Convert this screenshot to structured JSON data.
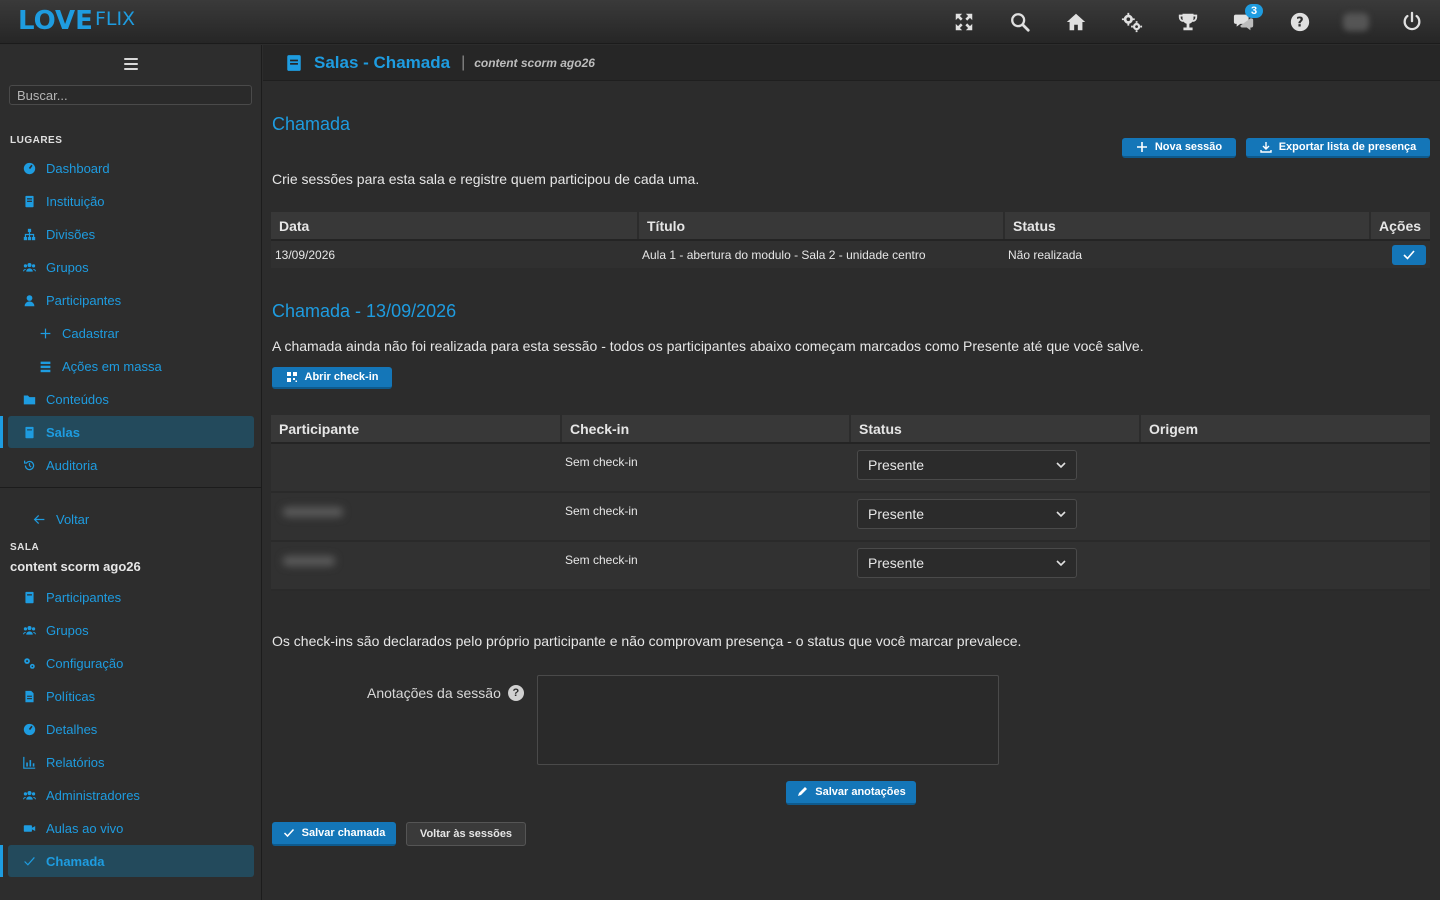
{
  "app": {
    "logo_love": "LOVE",
    "logo_flix": "FLIX",
    "notification_count": "3"
  },
  "colors": {
    "accent": "#1e9ce0",
    "button": "#1476b8",
    "background": "#2c2c2c"
  },
  "topbar_icons": [
    "fullscreen-icon",
    "search-icon",
    "home-icon",
    "settings-icon",
    "trophy-icon",
    "chat-icon",
    "help-icon",
    "avatar",
    "power-icon"
  ],
  "sidebar": {
    "search_placeholder": "Buscar...",
    "places_label": "LUGARES",
    "items": [
      {
        "label": "Dashboard",
        "icon": "dashboard-icon"
      },
      {
        "label": "Instituição",
        "icon": "building-icon"
      },
      {
        "label": "Divisões",
        "icon": "sitemap-icon"
      },
      {
        "label": "Grupos",
        "icon": "users-icon"
      },
      {
        "label": "Participantes",
        "icon": "user-icon"
      },
      {
        "label": "Cadastrar",
        "icon": "plus-icon"
      },
      {
        "label": "Ações em massa",
        "icon": "list-icon"
      },
      {
        "label": "Conteúdos",
        "icon": "folder-icon"
      },
      {
        "label": "Salas",
        "icon": "book-icon"
      },
      {
        "label": "Auditoria",
        "icon": "history-icon"
      }
    ],
    "back_label": "Voltar",
    "sala_label": "SALA",
    "sala_name": "content scorm ago26",
    "sala_items": [
      {
        "label": "Participantes",
        "icon": "book-icon"
      },
      {
        "label": "Grupos",
        "icon": "users-icon"
      },
      {
        "label": "Configuração",
        "icon": "cogs-icon"
      },
      {
        "label": "Políticas",
        "icon": "document-icon"
      },
      {
        "label": "Detalhes",
        "icon": "dashboard-icon"
      },
      {
        "label": "Relatórios",
        "icon": "chart-icon"
      },
      {
        "label": "Administradores",
        "icon": "users-icon"
      },
      {
        "label": "Aulas ao vivo",
        "icon": "video-icon"
      },
      {
        "label": "Chamada",
        "icon": "check-icon"
      }
    ]
  },
  "header": {
    "title": "Salas - Chamada",
    "subtitle": "content scorm ago26"
  },
  "main": {
    "heading": "Chamada",
    "new_session_label": "Nova sessão",
    "export_label": "Exportar lista de presença",
    "description": "Crie sessões para esta sala e registre quem participou de cada uma.",
    "sessions_table": {
      "headers": [
        "Data",
        "Título",
        "Status",
        "Ações"
      ],
      "rows": [
        {
          "date": "13/09/2026",
          "title": "Aula 1 - abertura do modulo - Sala 2 - unidade centro",
          "status": "Não realizada"
        }
      ]
    },
    "session_heading": "Chamada - 13/09/2026",
    "session_note": "A chamada ainda não foi realizada para esta sessão - todos os participantes abaixo começam marcados como Presente até que você salve.",
    "open_checkin_label": "Abrir check-in",
    "attendance_table": {
      "headers": [
        "Participante",
        "Check-in",
        "Status",
        "Origem"
      ],
      "rows": [
        {
          "checkin": "Sem check-in",
          "status": "Presente"
        },
        {
          "checkin": "Sem check-in",
          "status": "Presente"
        },
        {
          "checkin": "Sem check-in",
          "status": "Presente"
        }
      ]
    },
    "checkin_note": "Os check-ins são declarados pelo próprio participante e não comprovam presença - o status que você marcar prevalece.",
    "notes_label": "Anotações da sessão",
    "save_notes_label": "Salvar anotações",
    "save_attendance_label": "Salvar chamada",
    "back_sessions_label": "Voltar às sessões"
  }
}
